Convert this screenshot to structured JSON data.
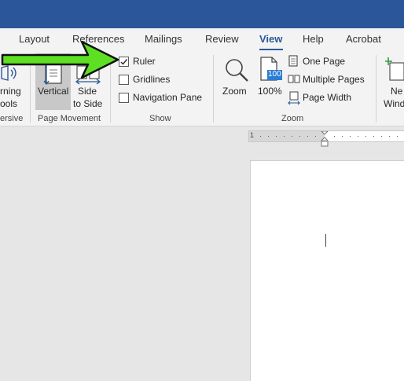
{
  "tabs": [
    {
      "label": "Layout"
    },
    {
      "label": "References"
    },
    {
      "label": "Mailings"
    },
    {
      "label": "Review"
    },
    {
      "label": "View"
    },
    {
      "label": "Help"
    },
    {
      "label": "Acrobat"
    }
  ],
  "ribbon": {
    "immersive": {
      "learning_line1": "rning",
      "learning_line2": "ools",
      "group_label": "ersive"
    },
    "page_movement": {
      "vertical": "Vertical",
      "side_line1": "Side",
      "side_line2": "to Side",
      "group_label": "Page Movement"
    },
    "show": {
      "ruler": {
        "label": "Ruler",
        "checked": true
      },
      "gridlines": {
        "label": "Gridlines",
        "checked": false
      },
      "navigation_pane": {
        "label": "Navigation Pane",
        "checked": false
      },
      "group_label": "Show"
    },
    "zoom": {
      "zoom": "Zoom",
      "zoom_100": "100%",
      "zoom_100_badge": "100",
      "one_page": "One Page",
      "multiple_pages": "Multiple Pages",
      "page_width": "Page Width",
      "group_label": "Zoom"
    },
    "window": {
      "new_line1": "Ne",
      "new_line2": "Wind"
    }
  },
  "ruler": {
    "tick_label": "1"
  },
  "colors": {
    "accent": "#2b579a",
    "arrow": "#5ee022",
    "arrow_outline": "#111111"
  }
}
